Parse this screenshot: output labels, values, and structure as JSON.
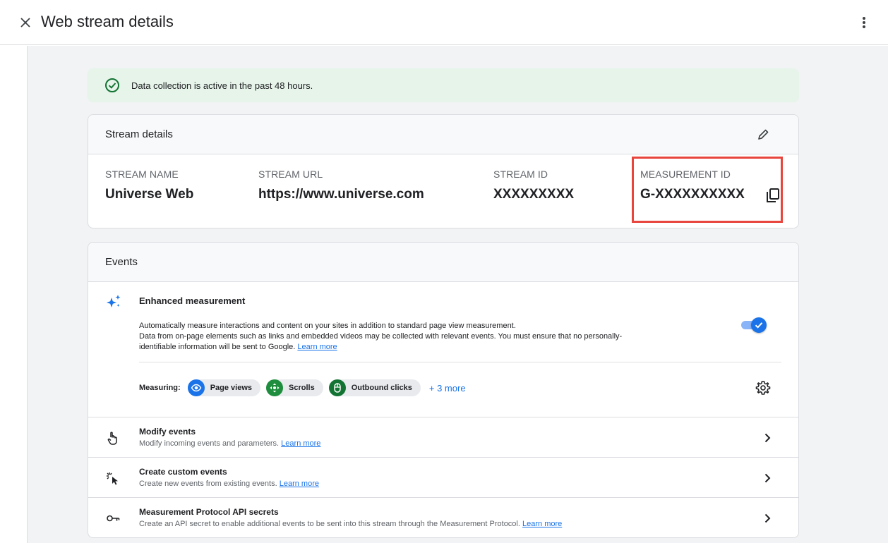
{
  "header": {
    "title": "Web stream details"
  },
  "banner": {
    "text": "Data collection is active in the past 48 hours.",
    "icon": "check-circle-icon"
  },
  "stream_details": {
    "title": "Stream details",
    "fields": [
      {
        "label": "STREAM NAME",
        "value": "Universe Web"
      },
      {
        "label": "STREAM URL",
        "value": "https://www.universe.com"
      },
      {
        "label": "STREAM ID",
        "value": "XXXXXXXXX"
      },
      {
        "label": "MEASUREMENT ID",
        "value": "G-XXXXXXXXXX"
      }
    ]
  },
  "events": {
    "title": "Events",
    "enhanced": {
      "title": "Enhanced measurement",
      "desc_line1": "Automatically measure interactions and content on your sites in addition to standard page view measurement.",
      "desc_line2": "Data from on-page elements such as links and embedded videos may be collected with relevant events. You must ensure that no personally-",
      "desc_line3": "identifiable information will be sent to Google.",
      "learn_more": "Learn more",
      "toggle_on": true,
      "measuring_label": "Measuring:",
      "chips": [
        {
          "label": "Page views",
          "icon": "eye-icon",
          "color": "#1a73e8"
        },
        {
          "label": "Scrolls",
          "icon": "scroll-icon",
          "color": "#1e8e3e"
        },
        {
          "label": "Outbound clicks",
          "icon": "mouse-icon",
          "color": "#137333"
        }
      ],
      "more_text": "+ 3 more"
    },
    "rows": [
      {
        "title": "Modify events",
        "subtitle": "Modify incoming events and parameters.",
        "link": "Learn more",
        "icon": "touch-icon"
      },
      {
        "title": "Create custom events",
        "subtitle": "Create new events from existing events.",
        "link": "Learn more",
        "icon": "sparkle-cursor-icon"
      },
      {
        "title": "Measurement Protocol API secrets",
        "subtitle": "Create an API secret to enable additional events to be sent into this stream through the Measurement Protocol.",
        "link": "Learn more",
        "icon": "key-icon"
      }
    ]
  },
  "colors": {
    "accent": "#1a73e8",
    "success_bg": "#e6f4ea",
    "highlight": "#e8453c"
  }
}
